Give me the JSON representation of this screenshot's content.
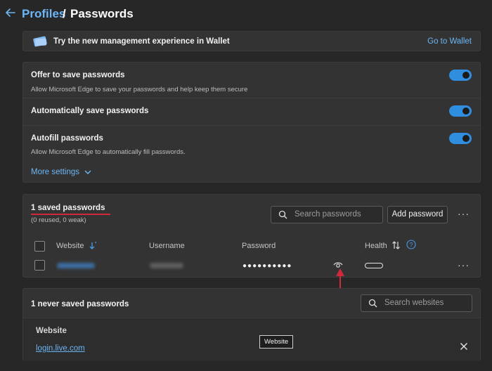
{
  "header": {
    "back_icon": "arrow-left-icon",
    "crumb_parent": "Profiles",
    "crumb_separator": "/",
    "crumb_current": "Passwords"
  },
  "wallet_banner": {
    "icon": "wallet-card-icon",
    "text": "Try the new management experience in Wallet",
    "link": "Go to Wallet"
  },
  "settings": {
    "items": [
      {
        "title": "Offer to save passwords",
        "desc": "Allow Microsoft Edge to save your passwords and help keep them secure",
        "on": true
      },
      {
        "title": "Automatically save passwords",
        "desc": "",
        "on": true
      },
      {
        "title": "Autofill passwords",
        "desc": "Allow Microsoft Edge to automatically fill passwords.",
        "on": true
      }
    ],
    "more_settings": "More settings"
  },
  "saved": {
    "title": "1 saved passwords",
    "subtitle": "(0 reused, 0 weak)",
    "search_placeholder": "Search passwords",
    "add_button": "Add password",
    "more_icon": "more-horizontal-icon",
    "columns": {
      "website": "Website",
      "username": "Username",
      "password": "Password",
      "health": "Health"
    },
    "row": {
      "password_mask": "●●●●●●●●●●"
    }
  },
  "never_saved": {
    "title": "1 never saved passwords",
    "search_placeholder": "Search websites",
    "column_header": "Website",
    "site": "login.live.com",
    "tooltip": "Website"
  },
  "colors": {
    "accent": "#6cb6f5",
    "toggle_on": "#2f8ee0",
    "annotation_red": "#d2283c",
    "background": "#272727",
    "card": "#333333"
  }
}
